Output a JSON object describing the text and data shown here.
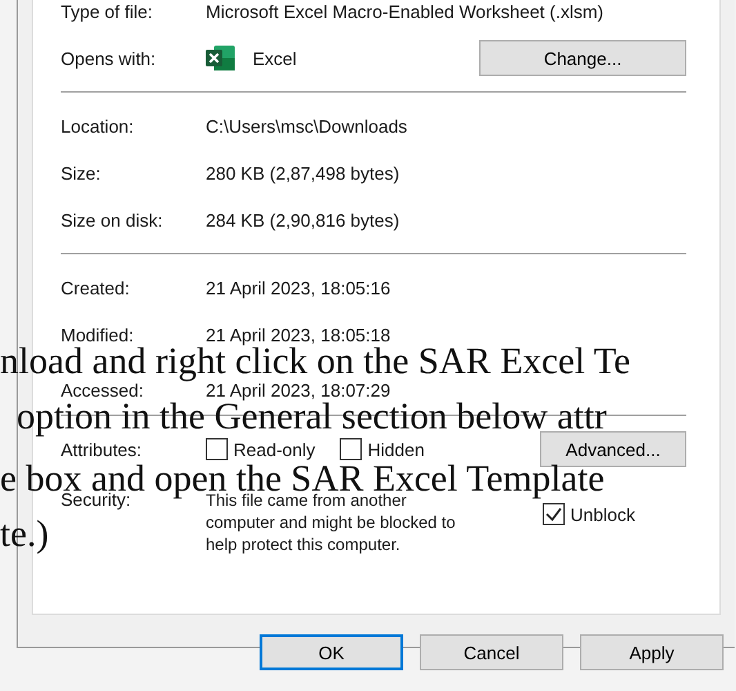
{
  "sections": [
    [
      {
        "kind": "text",
        "label": "Type of file:",
        "value": "Microsoft Excel Macro-Enabled Worksheet (.xlsm)"
      },
      {
        "kind": "app",
        "label": "Opens with:",
        "value": "Excel",
        "button": "Change..."
      }
    ],
    [
      {
        "kind": "text",
        "label": "Location:",
        "value": "C:\\Users\\msc\\Downloads"
      },
      {
        "kind": "text",
        "label": "Size:",
        "value": "280 KB (2,87,498 bytes)"
      },
      {
        "kind": "text",
        "label": "Size on disk:",
        "value": "284 KB (2,90,816 bytes)"
      }
    ],
    [
      {
        "kind": "text",
        "label": "Created:",
        "value": "21 April 2023, 18:05:16"
      },
      {
        "kind": "text",
        "label": "Modified:",
        "value": "21 April 2023, 18:05:18"
      },
      {
        "kind": "text",
        "label": "Accessed:",
        "value": "21 April 2023, 18:07:29"
      }
    ],
    [
      {
        "kind": "attributes",
        "label": "Attributes:",
        "checkboxes": [
          {
            "label": "Read-only",
            "checked": false
          },
          {
            "label": "Hidden",
            "checked": false
          }
        ],
        "button": "Advanced..."
      },
      {
        "kind": "security",
        "label": "Security:",
        "value": "This file came from another computer and might be blocked to help protect this computer.",
        "checkbox": {
          "label": "Unblock",
          "checked": true
        }
      }
    ]
  ],
  "buttons": [
    {
      "label": "OK",
      "default": true
    },
    {
      "label": "Cancel",
      "default": false
    },
    {
      "label": "Apply",
      "default": false
    }
  ],
  "overlay_text": [
    "nload and right click on the SAR Excel Te",
    "option in the General section below attr",
    "e box and open the SAR Excel Template",
    "te.)"
  ]
}
